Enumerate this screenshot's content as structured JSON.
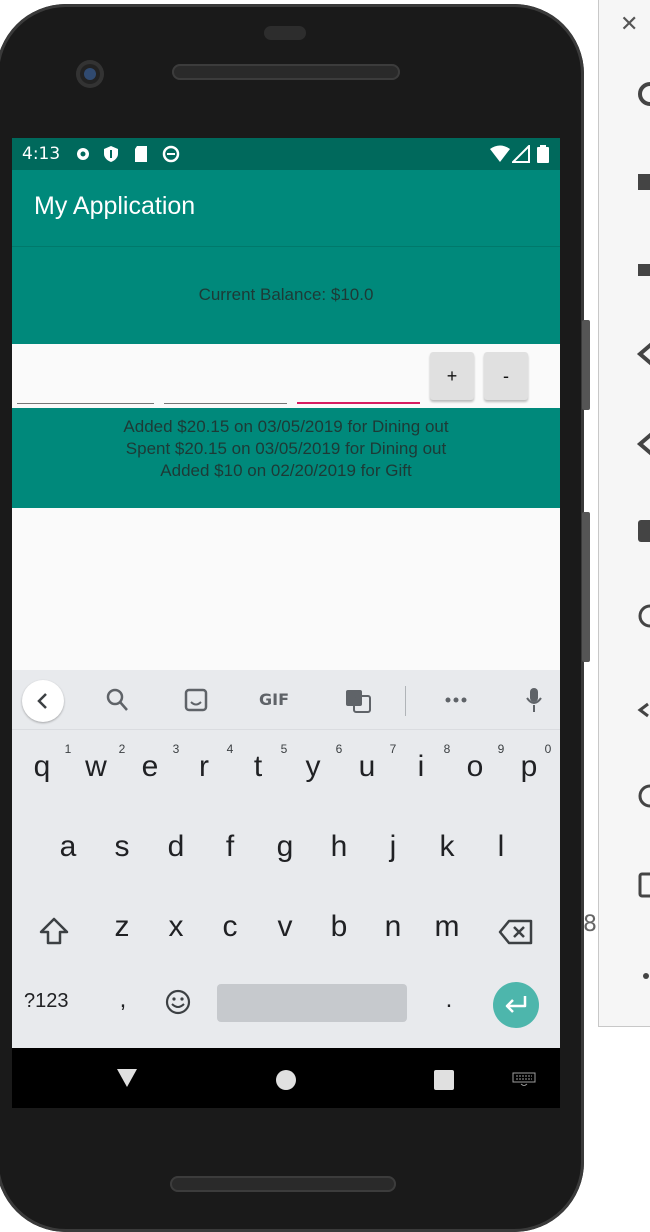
{
  "status_bar": {
    "time": "4:13"
  },
  "app_bar": {
    "title": "My Application"
  },
  "balance": {
    "text": "Current Balance: $10.0"
  },
  "inputs": [
    {
      "value": "",
      "placeholder": ""
    },
    {
      "value": "",
      "placeholder": ""
    },
    {
      "value": "",
      "placeholder": ""
    }
  ],
  "buttons": {
    "add_label": "+",
    "subtract_label": "-"
  },
  "history": [
    "Added $20.15 on 03/05/2019 for Dining out",
    "Spent $20.15 on 03/05/2019 for Dining out",
    "Added $10 on 02/20/2019 for Gift"
  ],
  "keyboard": {
    "toolbar": {
      "gif_label": "GIF"
    },
    "row1": [
      "q",
      "w",
      "e",
      "r",
      "t",
      "y",
      "u",
      "i",
      "o",
      "p"
    ],
    "row1_numbers": [
      "1",
      "2",
      "3",
      "4",
      "5",
      "6",
      "7",
      "8",
      "9",
      "0"
    ],
    "row2": [
      "a",
      "s",
      "d",
      "f",
      "g",
      "h",
      "j",
      "k",
      "l"
    ],
    "row3": [
      "z",
      "x",
      "c",
      "v",
      "b",
      "n",
      "m"
    ],
    "symbols_label": "?123",
    "comma": ",",
    "period": "."
  },
  "side_panel": {
    "partial_number": "8"
  },
  "colors": {
    "primary": "#00897b",
    "primary_dark": "#00695c",
    "accent": "#d81b60",
    "keyboard_bg": "#e8eaed",
    "enter_key": "#4db6ac"
  }
}
